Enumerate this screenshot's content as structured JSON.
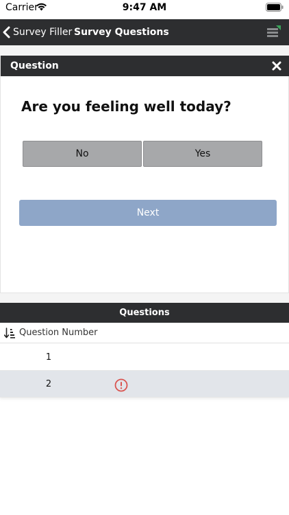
{
  "status_bar": {
    "carrier": "Carrier",
    "time": "9:47 AM"
  },
  "nav": {
    "back_label": "Survey Filler",
    "title": "Survey Questions",
    "bar_color": "#2d2e30",
    "menu_icon": "menu-icon"
  },
  "question_panel": {
    "header": "Question",
    "close_icon": "close-icon",
    "question": "Are you feeling well today?",
    "answers": [
      {
        "label": "No"
      },
      {
        "label": "Yes"
      }
    ],
    "next_label": "Next",
    "next_color": "#8ea6c8"
  },
  "questions_list": {
    "header": "Questions",
    "column_label": "Question Number",
    "sort_icon": "sort-descending-icon",
    "rows": [
      {
        "number": "1",
        "status": "none"
      },
      {
        "number": "2",
        "status": "alert",
        "status_color": "#d9534f"
      }
    ]
  }
}
